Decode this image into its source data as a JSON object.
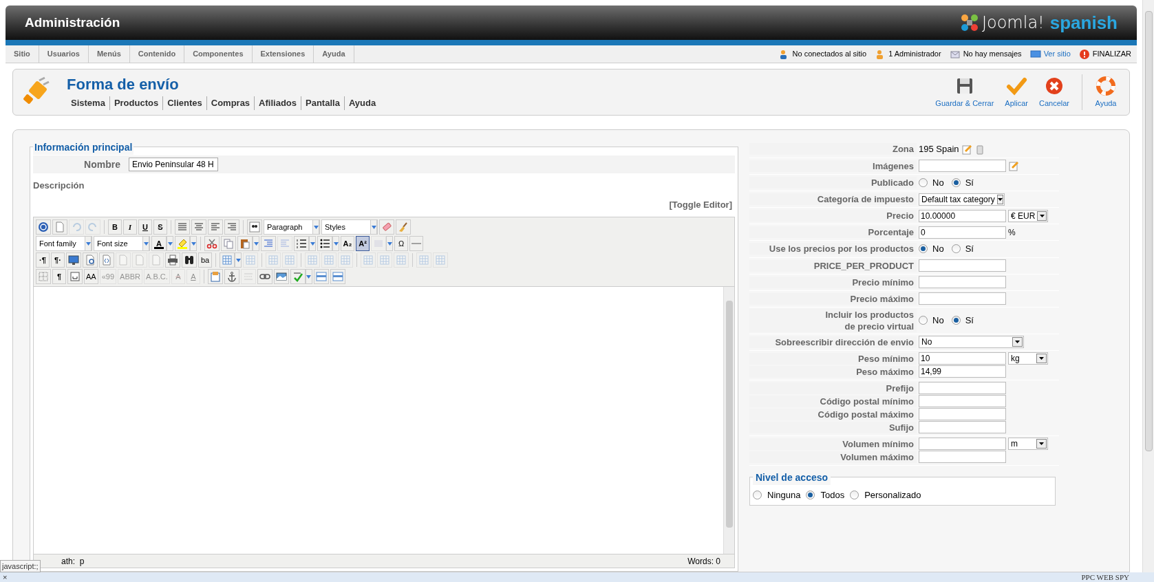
{
  "header": {
    "title": "Administración",
    "logo_word": "Joomla!",
    "logo_tag": "spanish"
  },
  "menu": [
    "Sitio",
    "Usuarios",
    "Menús",
    "Contenido",
    "Componentes",
    "Extensiones",
    "Ayuda"
  ],
  "status": [
    "No conectados al sitio",
    "1 Administrador",
    "No hay mensajes",
    "Ver sitio",
    "FINALIZAR"
  ],
  "toolbox": {
    "title": "Forma de envío",
    "submenu": [
      "Sistema",
      "Productos",
      "Clientes",
      "Compras",
      "Afiliados",
      "Pantalla",
      "Ayuda"
    ],
    "buttons": [
      "Guardar & Cerrar",
      "Aplicar",
      "Cancelar",
      "Ayuda"
    ]
  },
  "main": {
    "legend": "Información principal",
    "name_label": "Nombre",
    "name_value": "Envio Peninsular 48 H",
    "description_label": "Descripción",
    "toggle": "[Toggle Editor]",
    "toolbar": [
      [
        {
          "kind": "button",
          "disabled": false,
          "pressed": false
        },
        {
          "kind": "button",
          "disabled": false,
          "pressed": false
        },
        {
          "kind": "button",
          "disabled": true,
          "pressed": false
        },
        {
          "kind": "button",
          "disabled": true,
          "pressed": false
        },
        {
          "kind": "button",
          "glyph": "B",
          "disabled": false,
          "pressed": false
        },
        {
          "kind": "button",
          "glyph": "I",
          "disabled": false,
          "pressed": false
        },
        {
          "kind": "button",
          "glyph": "U",
          "disabled": false,
          "pressed": false
        },
        {
          "kind": "button",
          "glyph": "S",
          "disabled": false,
          "pressed": false
        },
        {
          "kind": "button",
          "disabled": false,
          "pressed": false
        },
        {
          "kind": "button",
          "disabled": false,
          "pressed": false
        },
        {
          "kind": "button",
          "disabled": false,
          "pressed": false
        },
        {
          "kind": "button",
          "disabled": false,
          "pressed": false
        },
        {
          "kind": "button",
          "disabled": false,
          "pressed": false
        },
        {
          "kind": "select",
          "value": "Paragraph"
        },
        {
          "kind": "select",
          "value": "Styles"
        },
        {
          "kind": "button",
          "disabled": false,
          "pressed": false
        },
        {
          "kind": "button",
          "disabled": false,
          "pressed": false
        }
      ],
      [
        {
          "kind": "select",
          "value": "Font family"
        },
        {
          "kind": "select",
          "value": "Font size"
        },
        {
          "kind": "button",
          "glyph": "A",
          "disabled": false,
          "pressed": false
        },
        {
          "kind": "button",
          "disabled": false,
          "pressed": false
        },
        {
          "kind": "button",
          "disabled": false,
          "pressed": false
        },
        {
          "kind": "button",
          "disabled": false,
          "pressed": false
        },
        {
          "kind": "button",
          "disabled": false,
          "pressed": false
        },
        {
          "kind": "button",
          "disabled": false,
          "pressed": false
        },
        {
          "kind": "button",
          "disabled": true,
          "pressed": false
        },
        {
          "kind": "button",
          "disabled": false,
          "pressed": false
        },
        {
          "kind": "button",
          "disabled": false,
          "pressed": false
        },
        {
          "kind": "button",
          "glyph": "A₂",
          "disabled": false,
          "pressed": false
        },
        {
          "kind": "button",
          "glyph": "A²",
          "disabled": false,
          "pressed": true
        },
        {
          "kind": "button",
          "disabled": true,
          "pressed": false
        },
        {
          "kind": "button",
          "glyph": "Ω",
          "disabled": false,
          "pressed": false
        },
        {
          "kind": "button",
          "disabled": false,
          "pressed": false
        }
      ],
      [
        {
          "kind": "button",
          "glyph": "·¶",
          "disabled": false,
          "pressed": false
        },
        {
          "kind": "button",
          "glyph": "¶·",
          "disabled": false,
          "pressed": false
        },
        {
          "kind": "button",
          "disabled": false,
          "pressed": false
        },
        {
          "kind": "button",
          "disabled": false,
          "pressed": false
        },
        {
          "kind": "button",
          "disabled": false,
          "pressed": false
        },
        {
          "kind": "button",
          "disabled": true,
          "pressed": false
        },
        {
          "kind": "button",
          "disabled": true,
          "pressed": false
        },
        {
          "kind": "button",
          "disabled": true,
          "pressed": false
        },
        {
          "kind": "button",
          "disabled": false,
          "pressed": false
        },
        {
          "kind": "button",
          "disabled": false,
          "pressed": false
        },
        {
          "kind": "button",
          "glyph": "ba",
          "disabled": false,
          "pressed": false
        },
        {
          "kind": "button",
          "disabled": false,
          "pressed": false
        },
        {
          "kind": "button",
          "disabled": true,
          "pressed": false
        },
        {
          "kind": "button",
          "disabled": true,
          "pressed": false
        },
        {
          "kind": "button",
          "disabled": true,
          "pressed": false
        },
        {
          "kind": "button",
          "disabled": true,
          "pressed": false
        },
        {
          "kind": "button",
          "disabled": true,
          "pressed": false
        },
        {
          "kind": "button",
          "disabled": true,
          "pressed": false
        },
        {
          "kind": "button",
          "disabled": true,
          "pressed": false
        },
        {
          "kind": "button",
          "disabled": true,
          "pressed": false
        },
        {
          "kind": "button",
          "disabled": true,
          "pressed": false
        },
        {
          "kind": "button",
          "disabled": true,
          "pressed": false
        },
        {
          "kind": "button",
          "disabled": true,
          "pressed": false
        }
      ],
      [
        {
          "kind": "button",
          "disabled": false,
          "pressed": false
        },
        {
          "kind": "button",
          "glyph": "¶",
          "disabled": false,
          "pressed": false
        },
        {
          "kind": "button",
          "disabled": false,
          "pressed": false
        },
        {
          "kind": "button",
          "glyph": "AA",
          "disabled": false,
          "pressed": false
        },
        {
          "kind": "button",
          "glyph": "«99",
          "disabled": true,
          "pressed": false
        },
        {
          "kind": "button",
          "glyph": "ABBR",
          "disabled": true,
          "pressed": false
        },
        {
          "kind": "button",
          "glyph": "A.B.C.",
          "disabled": true,
          "pressed": false
        },
        {
          "kind": "button",
          "glyph": "A",
          "disabled": true,
          "pressed": false
        },
        {
          "kind": "button",
          "glyph": "A",
          "disabled": true,
          "pressed": false
        },
        {
          "kind": "button",
          "disabled": false,
          "pressed": false
        },
        {
          "kind": "button",
          "disabled": false,
          "pressed": false
        },
        {
          "kind": "button",
          "disabled": true,
          "pressed": false
        },
        {
          "kind": "button",
          "disabled": false,
          "pressed": false
        },
        {
          "kind": "button",
          "disabled": false,
          "pressed": false
        },
        {
          "kind": "button",
          "disabled": false,
          "pressed": false
        },
        {
          "kind": "button",
          "disabled": false,
          "pressed": false
        },
        {
          "kind": "button",
          "disabled": false,
          "pressed": false
        }
      ]
    ],
    "path": "ath:  p",
    "words": "Words: 0"
  },
  "form": [
    [
      {
        "kind": "zone",
        "label": "Zona",
        "value": "195 Spain"
      }
    ],
    [
      {
        "kind": "image",
        "label": "Imágenes"
      }
    ],
    [
      {
        "kind": "radio",
        "label": "Publicado",
        "options": [
          {
            "label": "No",
            "selected": false
          },
          {
            "label": "Sí",
            "selected": true
          }
        ]
      }
    ],
    [
      {
        "kind": "select",
        "label": "Categoría de impuesto",
        "value": "Default tax category"
      }
    ],
    [
      {
        "kind": "input",
        "label": "Precio",
        "value": "10.00000",
        "unit": "€ EUR"
      }
    ],
    [
      {
        "kind": "input",
        "label": "Porcentaje",
        "value": "0",
        "suffix": "%"
      }
    ],
    [
      {
        "kind": "radio",
        "label": "Use los precios por los productos",
        "options": [
          {
            "label": "No",
            "selected": true
          },
          {
            "label": "Sí",
            "selected": false
          }
        ]
      }
    ],
    [
      {
        "kind": "input",
        "label": "PRICE_PER_PRODUCT"
      }
    ],
    [
      {
        "kind": "input",
        "label": "Precio mínimo"
      }
    ],
    [
      {
        "kind": "input",
        "label": "Precio máximo"
      }
    ],
    [
      {
        "kind": "radio",
        "label": "Incluir los productos\nde precio virtual",
        "options": [
          {
            "label": "No",
            "selected": false
          },
          {
            "label": "Sí",
            "selected": true
          }
        ]
      }
    ],
    [
      {
        "kind": "select",
        "label": "Sobreescribir dirección de envio",
        "value": "No"
      }
    ],
    [
      {
        "kind": "input",
        "label": "Peso mínimo",
        "value": "10",
        "unit": "kg"
      },
      {
        "kind": "input",
        "label": "Peso máximo",
        "value": "14,99"
      }
    ],
    [
      {
        "kind": "input",
        "label": "Prefijo"
      },
      {
        "kind": "input",
        "label": "Código postal mínimo"
      },
      {
        "kind": "input",
        "label": "Código postal máximo"
      },
      {
        "kind": "input",
        "label": "Sufijo"
      }
    ],
    [
      {
        "kind": "input",
        "label": "Volumen mínimo",
        "unit": "m"
      },
      {
        "kind": "input",
        "label": "Volumen máximo"
      }
    ]
  ],
  "access": {
    "legend": "Nivel de acceso",
    "options": [
      {
        "label": "Ninguna",
        "selected": false
      },
      {
        "label": "Todos",
        "selected": true
      },
      {
        "label": "Personalizado",
        "selected": false
      }
    ]
  },
  "browser": {
    "tooltip": "javascript:;",
    "close": "×",
    "brand": "PPC WEB SPY"
  }
}
